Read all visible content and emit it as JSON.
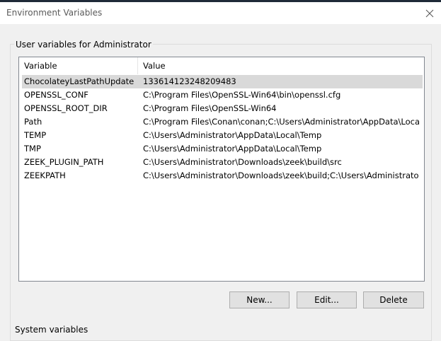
{
  "window": {
    "title": "Environment Variables",
    "close_icon": "close-icon"
  },
  "user_vars": {
    "group_label": "User variables for Administrator",
    "columns": {
      "name": "Variable",
      "value": "Value"
    },
    "rows": [
      {
        "name": "ChocolateyLastPathUpdate",
        "value": "133614123248209483"
      },
      {
        "name": "OPENSSL_CONF",
        "value": "C:\\Program Files\\OpenSSL-Win64\\bin\\openssl.cfg"
      },
      {
        "name": "OPENSSL_ROOT_DIR",
        "value": "C:\\Program Files\\OpenSSL-Win64"
      },
      {
        "name": "Path",
        "value": "C:\\Program Files\\Conan\\conan;C:\\Users\\Administrator\\AppData\\Local\\..."
      },
      {
        "name": "TEMP",
        "value": "C:\\Users\\Administrator\\AppData\\Local\\Temp"
      },
      {
        "name": "TMP",
        "value": "C:\\Users\\Administrator\\AppData\\Local\\Temp"
      },
      {
        "name": "ZEEK_PLUGIN_PATH",
        "value": "C:\\Users\\Administrator\\Downloads\\zeek\\build\\src"
      },
      {
        "name": "ZEEKPATH",
        "value": "C:\\Users\\Administrator\\Downloads\\zeek\\build;C:\\Users\\Administrator\\..."
      }
    ],
    "buttons": {
      "new": "New...",
      "edit": "Edit...",
      "delete": "Delete"
    }
  },
  "system_vars": {
    "group_label": "System variables"
  }
}
